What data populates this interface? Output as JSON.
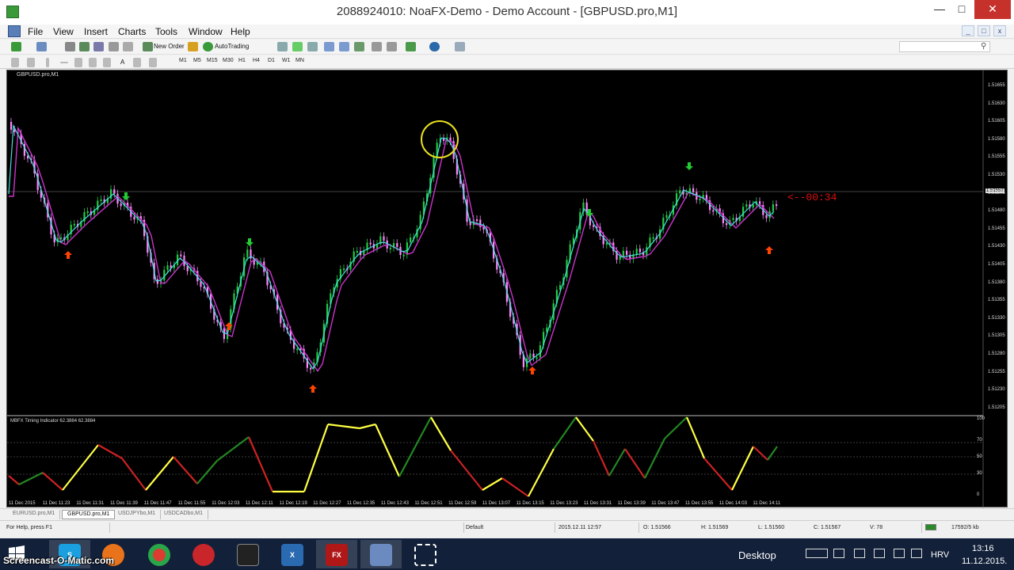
{
  "window": {
    "title": "2088924010: NoaFX-Demo - Demo Account - [GBPUSD.pro,M1]"
  },
  "menu": [
    "File",
    "View",
    "Insert",
    "Charts",
    "Tools",
    "Window",
    "Help"
  ],
  "toolbar": {
    "new_order_label": "New Order",
    "autotrading_label": "AutoTrading",
    "timeframes": [
      "M1",
      "M5",
      "M15",
      "M30",
      "H1",
      "H4",
      "D1",
      "W1",
      "MN"
    ]
  },
  "chart": {
    "symbol_label": "GBPUSD.pro,M1",
    "indicator_label": "MBFX Timing Indicator 62.3884 62.3884",
    "countdown": "<--00:34",
    "current_price": "1.51552",
    "price_ticks": [
      "1.51655",
      "1.51630",
      "1.51605",
      "1.51580",
      "1.51555",
      "1.51530",
      "1.51505",
      "1.51480",
      "1.51455",
      "1.51430",
      "1.51405",
      "1.51380",
      "1.51355",
      "1.51330",
      "1.51305",
      "1.51280",
      "1.51255",
      "1.51230",
      "1.51205"
    ],
    "osc_ticks": [
      "100",
      "70",
      "50",
      "30",
      "0"
    ],
    "time_ticks": [
      "11 Dec 2015",
      "11 Dec 11:23",
      "11 Dec 11:31",
      "11 Dec 11:39",
      "11 Dec 11:47",
      "11 Dec 11:55",
      "11 Dec 12:03",
      "11 Dec 12:11",
      "11 Dec 12:19",
      "11 Dec 12:27",
      "11 Dec 12:35",
      "11 Dec 12:43",
      "11 Dec 12:51",
      "11 Dec 12:59",
      "11 Dec 13:07",
      "11 Dec 13:15",
      "11 Dec 13:23",
      "11 Dec 13:31",
      "11 Dec 13:39",
      "11 Dec 13:47",
      "11 Dec 13:55",
      "11 Dec 14:03",
      "11 Dec 14:11"
    ]
  },
  "tabs": [
    {
      "label": "EURUSD.pro,M1",
      "active": false
    },
    {
      "label": "GBPUSD.pro,M1",
      "active": true
    },
    {
      "label": "USDJPYbo,M1",
      "active": false
    },
    {
      "label": "USDCADbo,M1",
      "active": false
    }
  ],
  "status": {
    "help": "For Help, press F1",
    "profile": "Default",
    "datetime": "2015.12.11 12:57",
    "open": "O: 1.51566",
    "high": "H: 1.51569",
    "low": "L: 1.51560",
    "close": "C: 1.51567",
    "volume": "V: 78",
    "traffic": "17592/5 kb"
  },
  "taskbar": {
    "watermark": "Screencast-O-Matic.com",
    "desktop_label": "Desktop",
    "language": "HRV",
    "time": "13:16",
    "date": "11.12.2015."
  },
  "colors": {
    "bull_candle": "#22cc44",
    "bear_candle": "#ff88ff",
    "slow_ma": "#cc33cc",
    "fast_ma": "#44dddd",
    "arrow_up": "#ff4400",
    "arrow_down": "#22cc33",
    "osc_up": "#228822",
    "osc_down": "#cc2222",
    "osc_extreme": "#ffff44"
  }
}
